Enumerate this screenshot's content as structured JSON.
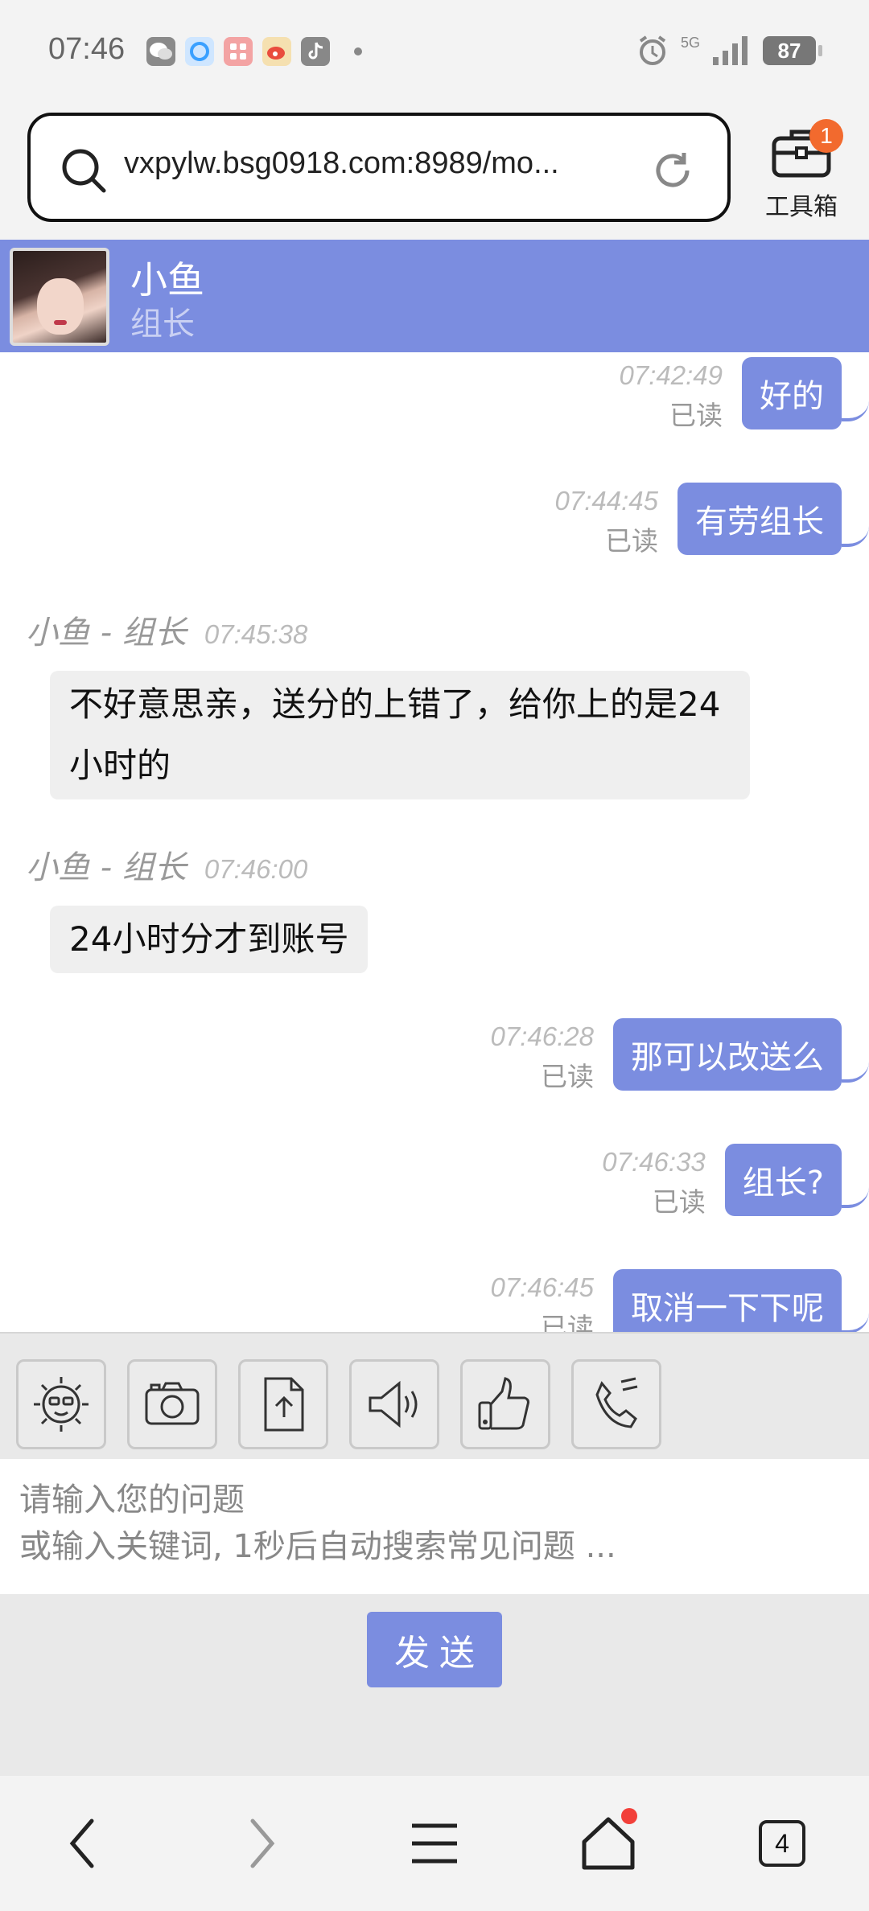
{
  "status_bar": {
    "time": "07:46",
    "network": "5G",
    "battery": "87",
    "app_icons": [
      "wechat-icon",
      "qq-browser-icon",
      "meitu-icon",
      "weibo-icon",
      "tiktok-icon"
    ]
  },
  "browser": {
    "url": "vxpylw.bsg0918.com:8989/mo...",
    "toolbox_label": "工具箱",
    "toolbox_badge": "1",
    "tab_count": "4"
  },
  "chat_header": {
    "name": "小鱼",
    "role": "组长"
  },
  "messages": [
    {
      "side": "right",
      "time": "07:42:49",
      "status": "已读",
      "text": "好的"
    },
    {
      "side": "right",
      "time": "07:44:45",
      "status": "已读",
      "text": "有劳组长"
    },
    {
      "side": "left",
      "sender": "小鱼 - 组长",
      "time": "07:45:38",
      "text": "不好意思亲，送分的上错了，给你上的是24小时的"
    },
    {
      "side": "left",
      "sender": "小鱼 - 组长",
      "time": "07:46:00",
      "text": "24小时分才到账号"
    },
    {
      "side": "right",
      "time": "07:46:28",
      "status": "已读",
      "text": "那可以改送么"
    },
    {
      "side": "right",
      "time": "07:46:33",
      "status": "已读",
      "text": "组长?"
    },
    {
      "side": "right",
      "time": "07:46:45",
      "status": "已读",
      "text": "取消一下下呢"
    }
  ],
  "tools": [
    "emoji-icon",
    "camera-icon",
    "upload-file-icon",
    "voice-icon",
    "thumbs-up-icon",
    "phone-icon"
  ],
  "input": {
    "placeholder": "请输入您的问题\n或输入关键词, 1秒后自动搜索常见问题 ..."
  },
  "send_label": "发送",
  "colors": {
    "accent": "#7b8de0",
    "left_bubble": "#efefef",
    "badge": "#f26a2e"
  }
}
